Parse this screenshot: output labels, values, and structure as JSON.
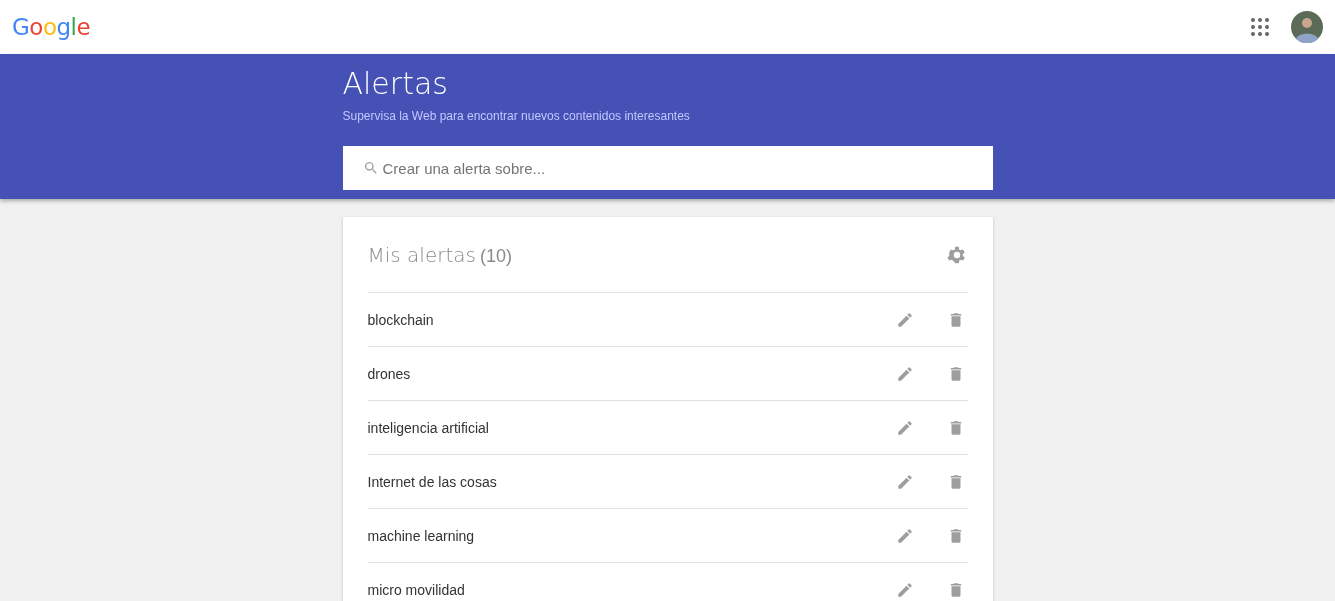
{
  "header": {
    "logo": "Google"
  },
  "banner": {
    "title": "Alertas",
    "subtitle": "Supervisa la Web para encontrar nuevos contenidos interesantes",
    "search": {
      "placeholder": "Crear una alerta sobre..."
    }
  },
  "alerts": {
    "title": "Mis alertas",
    "count": "(10)",
    "items": [
      {
        "name": "blockchain"
      },
      {
        "name": "drones"
      },
      {
        "name": "inteligencia artificial"
      },
      {
        "name": "Internet de las cosas"
      },
      {
        "name": "machine learning"
      },
      {
        "name": "micro movilidad"
      }
    ]
  }
}
